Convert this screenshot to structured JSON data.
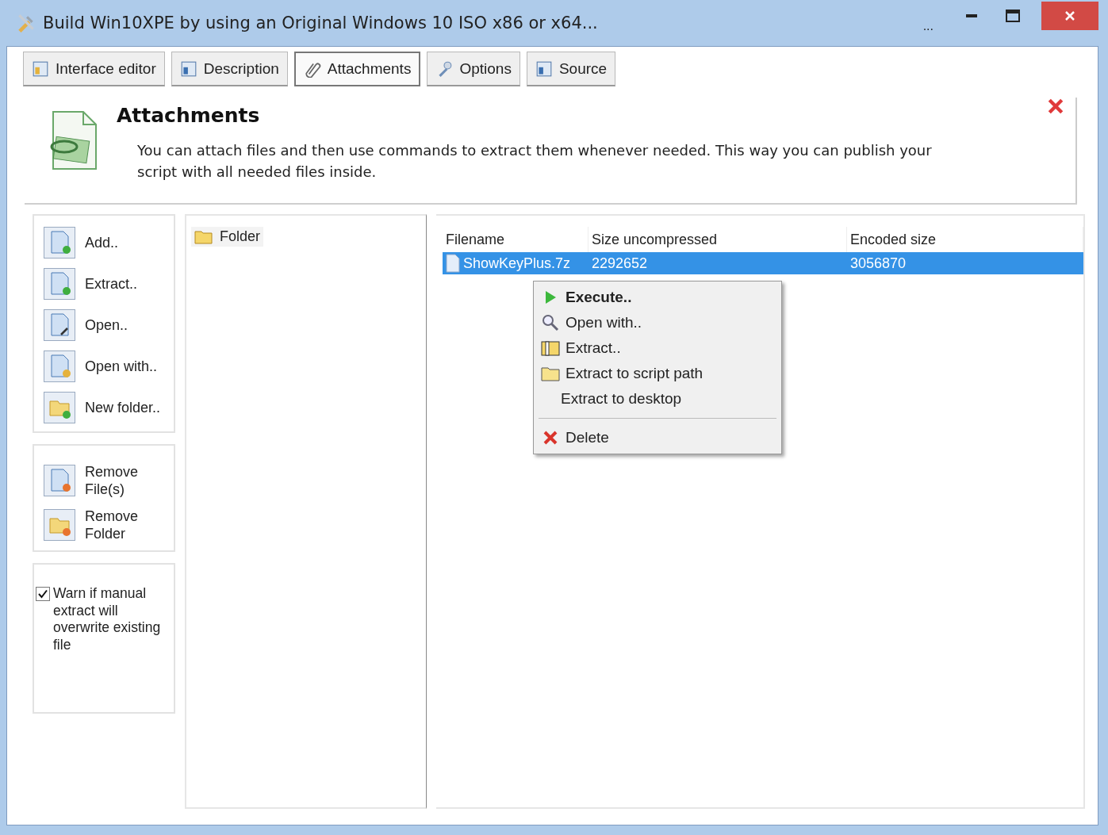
{
  "window": {
    "title": "Build Win10XPE by using an Original Windows 10 ISO x86 or x64...",
    "controls": [
      "..."
    ]
  },
  "tabs": [
    {
      "label": "Interface editor",
      "selected": false
    },
    {
      "label": "Description",
      "selected": false
    },
    {
      "label": "Attachments",
      "selected": true
    },
    {
      "label": "Options",
      "selected": false
    },
    {
      "label": "Source",
      "selected": false
    }
  ],
  "header": {
    "title": "Attachments",
    "description": "You can attach files and then use commands to extract them whenever needed. This way you can publish your script with all needed files inside."
  },
  "actions": [
    [
      {
        "label": "Add.."
      },
      {
        "label": "Extract.."
      },
      {
        "label": "Open.."
      },
      {
        "label": "Open with.."
      },
      {
        "label": "New folder.."
      }
    ],
    [
      {
        "label": "Remove File(s)"
      },
      {
        "label": "Remove Folder"
      }
    ]
  ],
  "warn_checkbox": {
    "label": "Warn if manual extract will overwrite existing file",
    "checked": true
  },
  "folders": [
    {
      "name": "Folder"
    }
  ],
  "table": {
    "columns": [
      "Filename",
      "Size uncompressed",
      "Encoded size"
    ],
    "rows": [
      {
        "cells": [
          "ShowKeyPlus.7z",
          "2292652",
          "3056870"
        ],
        "selected": true
      }
    ]
  },
  "context_menu": [
    {
      "kind": "item",
      "label": "Execute..",
      "default": true
    },
    {
      "kind": "item",
      "label": "Open with..",
      "default": false
    },
    {
      "kind": "item",
      "label": "Extract..",
      "default": false
    },
    {
      "kind": "item",
      "label": "Extract to script path",
      "default": false
    },
    {
      "kind": "item",
      "label": "Extract to desktop",
      "default": false
    },
    {
      "kind": "separator"
    },
    {
      "kind": "item",
      "label": "Delete",
      "default": false
    }
  ]
}
